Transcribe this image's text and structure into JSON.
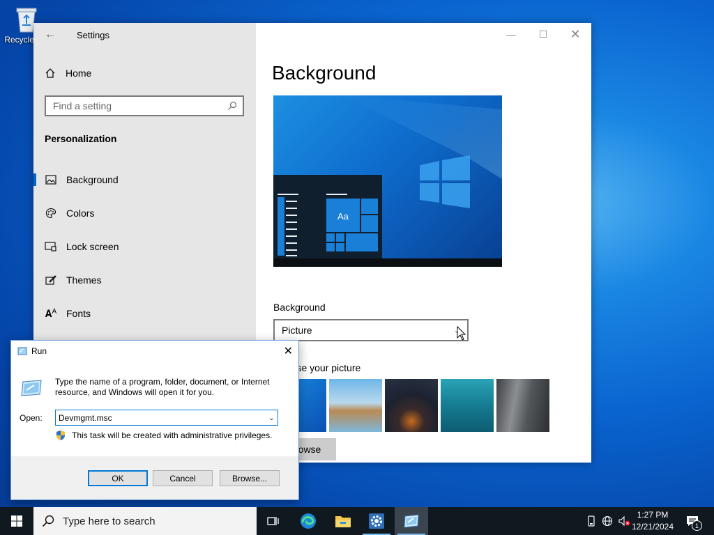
{
  "desktop": {
    "recycle_bin_label": "Recycle Bin"
  },
  "settings": {
    "window_title": "Settings",
    "home_label": "Home",
    "search_placeholder": "Find a setting",
    "section_title": "Personalization",
    "nav_items": [
      {
        "label": "Background",
        "icon": "picture-icon",
        "selected": true
      },
      {
        "label": "Colors",
        "icon": "palette-icon",
        "selected": false
      },
      {
        "label": "Lock screen",
        "icon": "lock-screen-icon",
        "selected": false
      },
      {
        "label": "Themes",
        "icon": "themes-icon",
        "selected": false
      },
      {
        "label": "Fonts",
        "icon": "fonts-icon",
        "selected": false
      }
    ],
    "page_title": "Background",
    "preview_tile_text": "Aa",
    "background_label": "Background",
    "background_value": "Picture",
    "choose_picture_label": "Choose your picture",
    "browse_label": "Browse"
  },
  "run_dialog": {
    "title": "Run",
    "description": "Type the name of a program, folder, document, or Internet resource, and Windows will open it for you.",
    "open_label": "Open:",
    "open_value": "Devmgmt.msc",
    "admin_note": "This task will be created with administrative privileges.",
    "ok_label": "OK",
    "cancel_label": "Cancel",
    "browse_label": "Browse..."
  },
  "taskbar": {
    "search_placeholder": "Type here to search",
    "time": "1:27 PM",
    "date": "12/21/2024",
    "notification_count": "1",
    "accent_color": "#76b9ed"
  }
}
